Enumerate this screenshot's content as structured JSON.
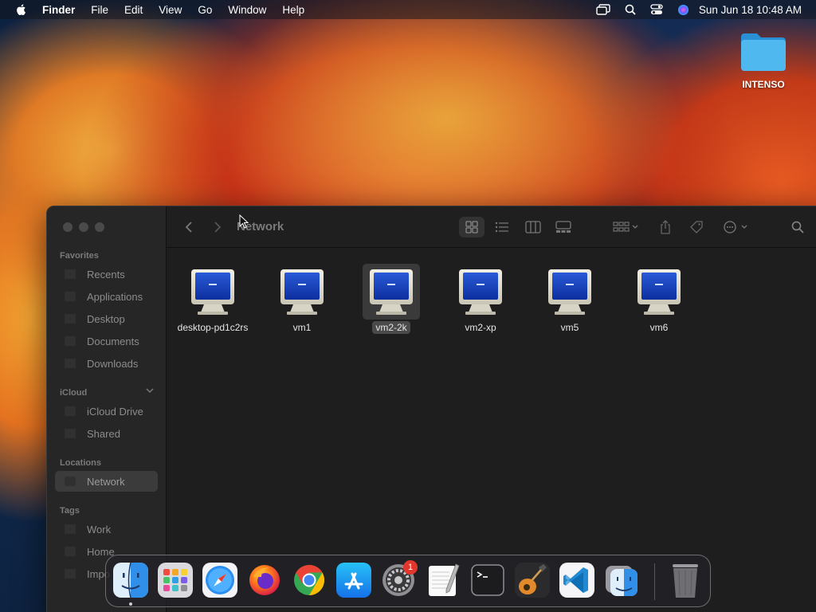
{
  "menubar": {
    "app_name": "Finder",
    "menus": [
      "File",
      "Edit",
      "View",
      "Go",
      "Window",
      "Help"
    ],
    "clock": "Sun Jun 18  10:48 AM"
  },
  "desktop": {
    "icons": [
      {
        "label": "INTENSO",
        "icon": "folder-icon"
      }
    ]
  },
  "finder": {
    "title": "Network",
    "sidebar": {
      "favorites_label": "Favorites",
      "favorites": [
        "Recents",
        "Applications",
        "Desktop",
        "Documents",
        "Downloads"
      ],
      "icloud_label": "iCloud",
      "icloud": [
        "iCloud Drive",
        "Shared"
      ],
      "locations_label": "Locations",
      "locations": [
        "Network"
      ],
      "tags_label": "Tags",
      "tags": [
        "Work",
        "Home",
        "Impo"
      ]
    },
    "items": [
      {
        "name": "desktop-pd1c2rs",
        "selected": false
      },
      {
        "name": "vm1",
        "selected": false
      },
      {
        "name": "vm2-2k",
        "selected": true
      },
      {
        "name": "vm2-xp",
        "selected": false
      },
      {
        "name": "vm5",
        "selected": false
      },
      {
        "name": "vm6",
        "selected": false
      }
    ]
  },
  "dock": {
    "apps": [
      "Finder",
      "Launchpad",
      "Safari",
      "Firefox",
      "Chrome",
      "App Store",
      "System Settings",
      "TextEdit",
      "Terminal",
      "GarageBand",
      "Visual Studio Code",
      "Finder",
      "Trash"
    ],
    "system_settings_badge": "1"
  },
  "colors": {
    "accent_selection": "#3a3a3a",
    "badge_red": "#e0362c",
    "folder_blue": "#34a8e6"
  }
}
